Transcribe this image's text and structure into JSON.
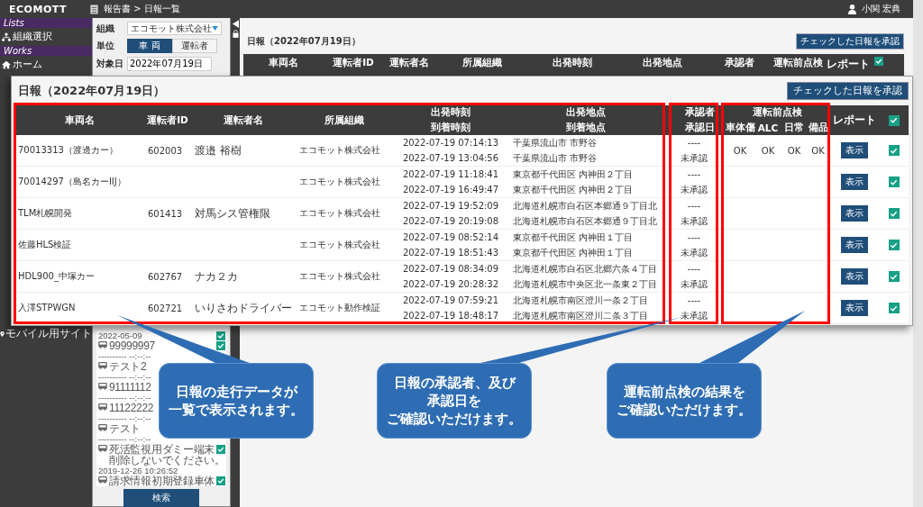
{
  "top_bar": {
    "logo": "ECOMOTT",
    "breadcrumb": "報告書 > 日報一覧",
    "user": "小関 宏典"
  },
  "sidebar": {
    "sections": [
      {
        "heading": "Lists",
        "items": [
          {
            "label": "組織選択",
            "kind": "org"
          }
        ]
      },
      {
        "heading": "Works",
        "items": [
          {
            "label": "ホーム",
            "kind": "home"
          }
        ]
      }
    ],
    "bottom_items": [
      {
        "label": "モバイル用サイト",
        "kind": "pin"
      }
    ]
  },
  "filter": {
    "fields": [
      {
        "label": "組織",
        "kind": "select",
        "value": "エコモット株式会社"
      },
      {
        "label": "単位",
        "kind": "toggle",
        "options": [
          {
            "label": "車 両",
            "selected": true
          },
          {
            "label": "運転者",
            "selected": false
          }
        ]
      },
      {
        "label": "対象日",
        "kind": "date",
        "value": "2022年07月19日"
      }
    ],
    "vehicles": [
      {
        "time": "2022-05-09",
        "checked": true
      },
      {
        "name": "99999997",
        "time": "---------- --:--:--",
        "checked": true
      },
      {
        "name": "テスト2",
        "time": "---------- --:--:--"
      },
      {
        "name": "91111112",
        "time": "---------- --:--:--"
      },
      {
        "name": "11122222",
        "time": "---------- --:--:--"
      },
      {
        "name": "テスト",
        "time": "---------- --:--:--"
      },
      {
        "name": [
          "死活監視用ダミー端末",
          "削除しないでください。"
        ],
        "time": "2019-12-26 10:26:52",
        "checked": true
      },
      {
        "name": "請求情報初期登録車体",
        "checked": true
      }
    ],
    "search_button": "検索"
  },
  "background_report": {
    "title": "日報（2022年07月19日）",
    "approve_button": "チェックした日報を承認",
    "columns": [
      "車両名",
      "運転者ID",
      "運転者名",
      "所属組織",
      "出発時刻",
      "出発地点",
      "承認者",
      "運転前点検",
      "レポート"
    ],
    "all_checked": true
  },
  "report": {
    "title": "日報（2022年07月19日）",
    "approve_button": "チェックした日報を承認",
    "header": {
      "vehicle": "車両名",
      "driver_id": "運転者ID",
      "driver_name": "運転者名",
      "org": "所属組織",
      "depart_time": "出発時刻",
      "arrive_time": "到着時刻",
      "depart_place": "出発地点",
      "arrive_place": "到着地点",
      "approver": "承認者",
      "approval_date": "承認日",
      "inspection": "運転前点検",
      "inspection_items": [
        "車体傷",
        "ALC",
        "日常",
        "備品"
      ],
      "report": "レポート",
      "all_checked": true
    },
    "rows": [
      {
        "vehicle": "70013313（渡邊カー）",
        "driver_id": "602003",
        "driver_name": "渡邉 裕樹",
        "org": "エコモット株式会社",
        "depart_time": "2022-07-19 07:14:13",
        "arrive_time": "2022-07-19 13:04:56",
        "depart_place": "千葉県流山市 市野谷",
        "arrive_place": "千葉県流山市 市野谷",
        "approver": "----",
        "approval": "未承認",
        "inspection": [
          "OK",
          "OK",
          "OK",
          "OK"
        ],
        "report_button": "表示",
        "checked": true
      },
      {
        "vehicle": "70014297（島名カーIIJ）",
        "org": "エコモット株式会社",
        "depart_time": "2022-07-19 11:18:41",
        "arrive_time": "2022-07-19 16:49:47",
        "depart_place": "東京都千代田区 内神田２丁目",
        "arrive_place": "東京都千代田区 内神田２丁目",
        "approver": "----",
        "approval": "未承認",
        "report_button": "表示",
        "checked": true
      },
      {
        "vehicle": "TLM札幌開発",
        "driver_id": "601413",
        "driver_name": "対馬シス管権限",
        "org": "エコモット株式会社",
        "depart_time": "2022-07-19 19:52:09",
        "arrive_time": "2022-07-19 20:19:08",
        "depart_place": "北海道札幌市白石区本郷通９丁目北",
        "arrive_place": "北海道札幌市白石区本郷通９丁目北",
        "approver": "----",
        "approval": "未承認",
        "report_button": "表示",
        "checked": true
      },
      {
        "vehicle": "佐藤HLS検証",
        "org": "エコモット株式会社",
        "depart_time": "2022-07-19 08:52:14",
        "arrive_time": "2022-07-19 18:51:43",
        "depart_place": "東京都千代田区 内神田１丁目",
        "arrive_place": "東京都千代田区 内神田１丁目",
        "approver": "----",
        "approval": "未承認",
        "report_button": "表示",
        "checked": true
      },
      {
        "vehicle": "HDL900_中塚カー",
        "driver_id": "602767",
        "driver_name": "ナカ２カ",
        "org": "エコモット株式会社",
        "depart_time": "2022-07-19 08:34:09",
        "arrive_time": "2022-07-19 20:28:32",
        "depart_place": "北海道札幌市白石区北郷六条４丁目",
        "arrive_place": "北海道札幌市中央区北一条東２丁目",
        "approver": "----",
        "approval": "未承認",
        "report_button": "表示",
        "checked": true
      },
      {
        "vehicle": "入澤STPWGN",
        "driver_id": "602721",
        "driver_name": "いりさわドライバー",
        "org": "エコモット動作検証",
        "depart_time": "2022-07-19 07:59:21",
        "arrive_time": "2022-07-19 18:48:17",
        "depart_place": "北海道札幌市南区澄川一条２丁目",
        "arrive_place": "北海道札幌市南区澄川二条３丁目",
        "approver": "----",
        "approval": "未承認",
        "report_button": "表示",
        "checked": true
      }
    ]
  },
  "callouts": [
    {
      "lines": [
        "日報の走行データが",
        "一覧で表示されます。"
      ]
    },
    {
      "lines": [
        "日報の承認者、及び",
        "承認日を",
        "ご確認いただけます。"
      ]
    },
    {
      "lines": [
        "運転前点検の結果を",
        "ご確認いただけます。"
      ]
    }
  ]
}
